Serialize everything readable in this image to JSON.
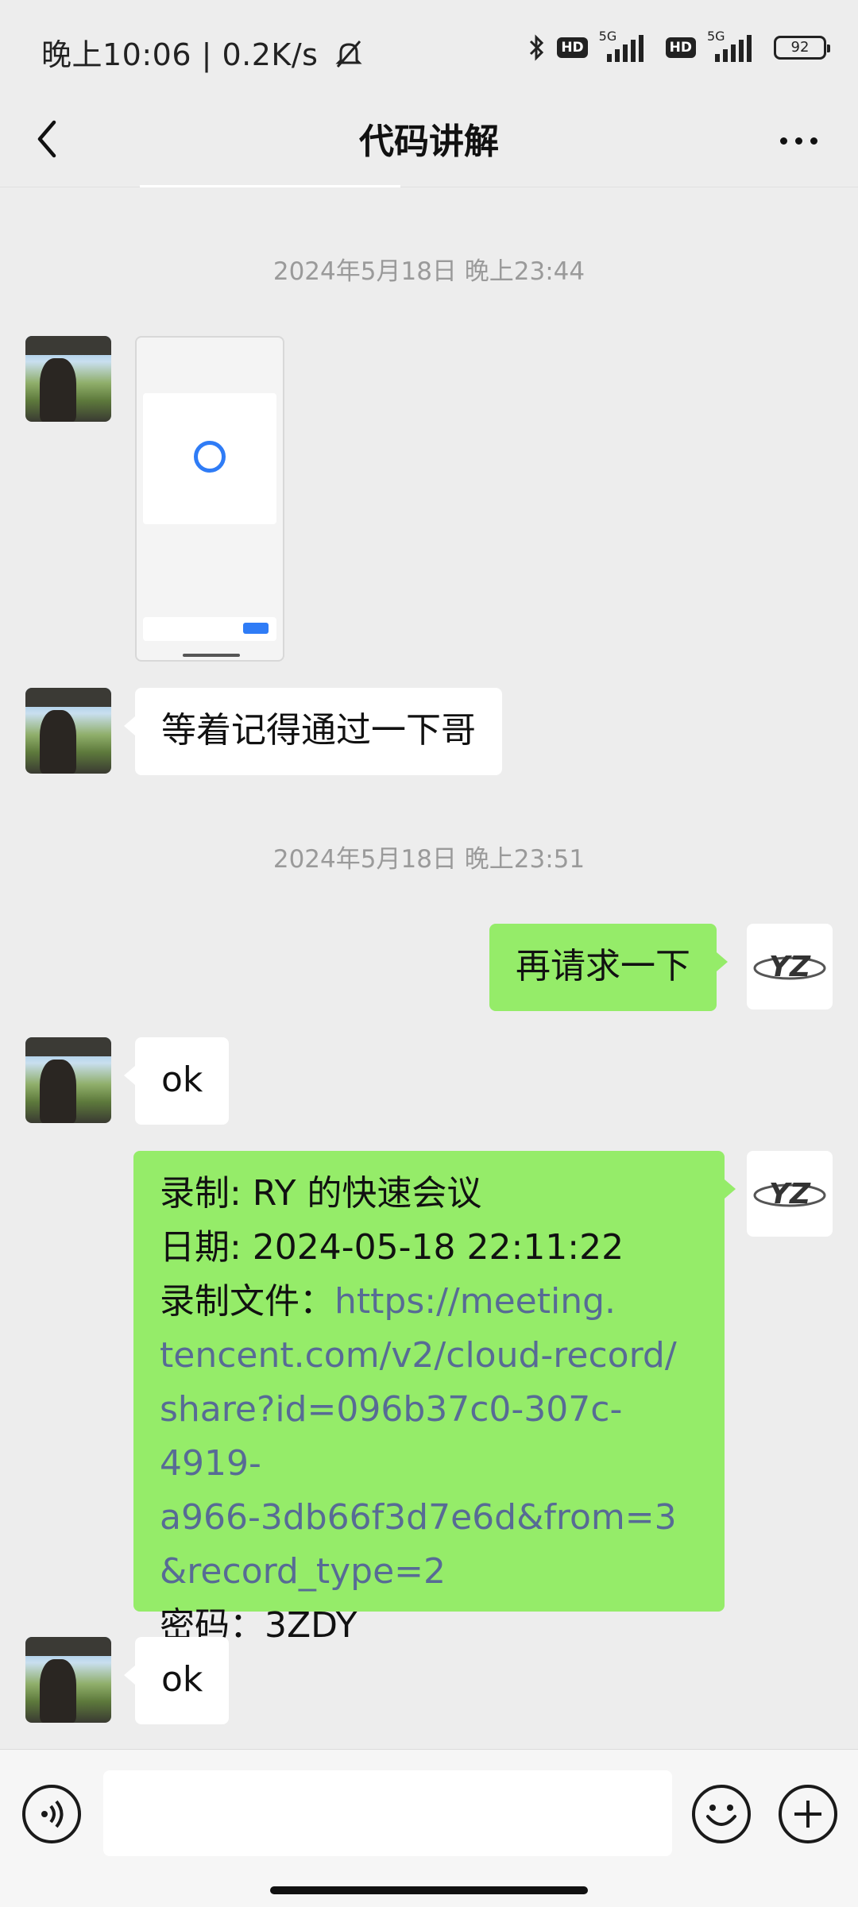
{
  "status_bar": {
    "time_speed": "晚上10:06 | 0.2K/s",
    "hd_label": "HD",
    "network_label": "5G",
    "battery": "92"
  },
  "nav": {
    "title": "代码讲解"
  },
  "messages": [
    {
      "type": "timestamp",
      "text": "2024年5月18日 晚上23:44"
    },
    {
      "type": "image",
      "from": "other"
    },
    {
      "type": "text",
      "from": "other",
      "text": "等着记得通过一下哥"
    },
    {
      "type": "timestamp",
      "text": "2024年5月18日 晚上23:51"
    },
    {
      "type": "text",
      "from": "me",
      "text": "再请求一下"
    },
    {
      "type": "text",
      "from": "other",
      "text": "ok"
    },
    {
      "type": "text",
      "from": "me",
      "line1": "录制: RY 的快速会议",
      "line2": "日期: 2024-05-18 22:11:22",
      "line3_label": "录制文件：",
      "link_l1": "https://meeting.",
      "link_l2": "tencent.com/v2/cloud-record/",
      "link_l3": "share?id=096b37c0-307c-4919-",
      "link_l4": "a966-3db66f3d7e6d&from=3",
      "link_l5": "&record_type=2",
      "line4": "密码：3ZDY"
    },
    {
      "type": "text",
      "from": "other",
      "text": "ok"
    }
  ],
  "input": {
    "value": "",
    "placeholder": ""
  },
  "colors": {
    "bubble_out": "#95ec69",
    "bubble_in": "#ffffff",
    "background": "#ededed",
    "link": "#576b95"
  },
  "icons": {
    "voice": "voice-icon",
    "emoji": "emoji-icon",
    "plus": "plus-icon",
    "back": "back-arrow-icon",
    "more": "more-dots-icon"
  }
}
